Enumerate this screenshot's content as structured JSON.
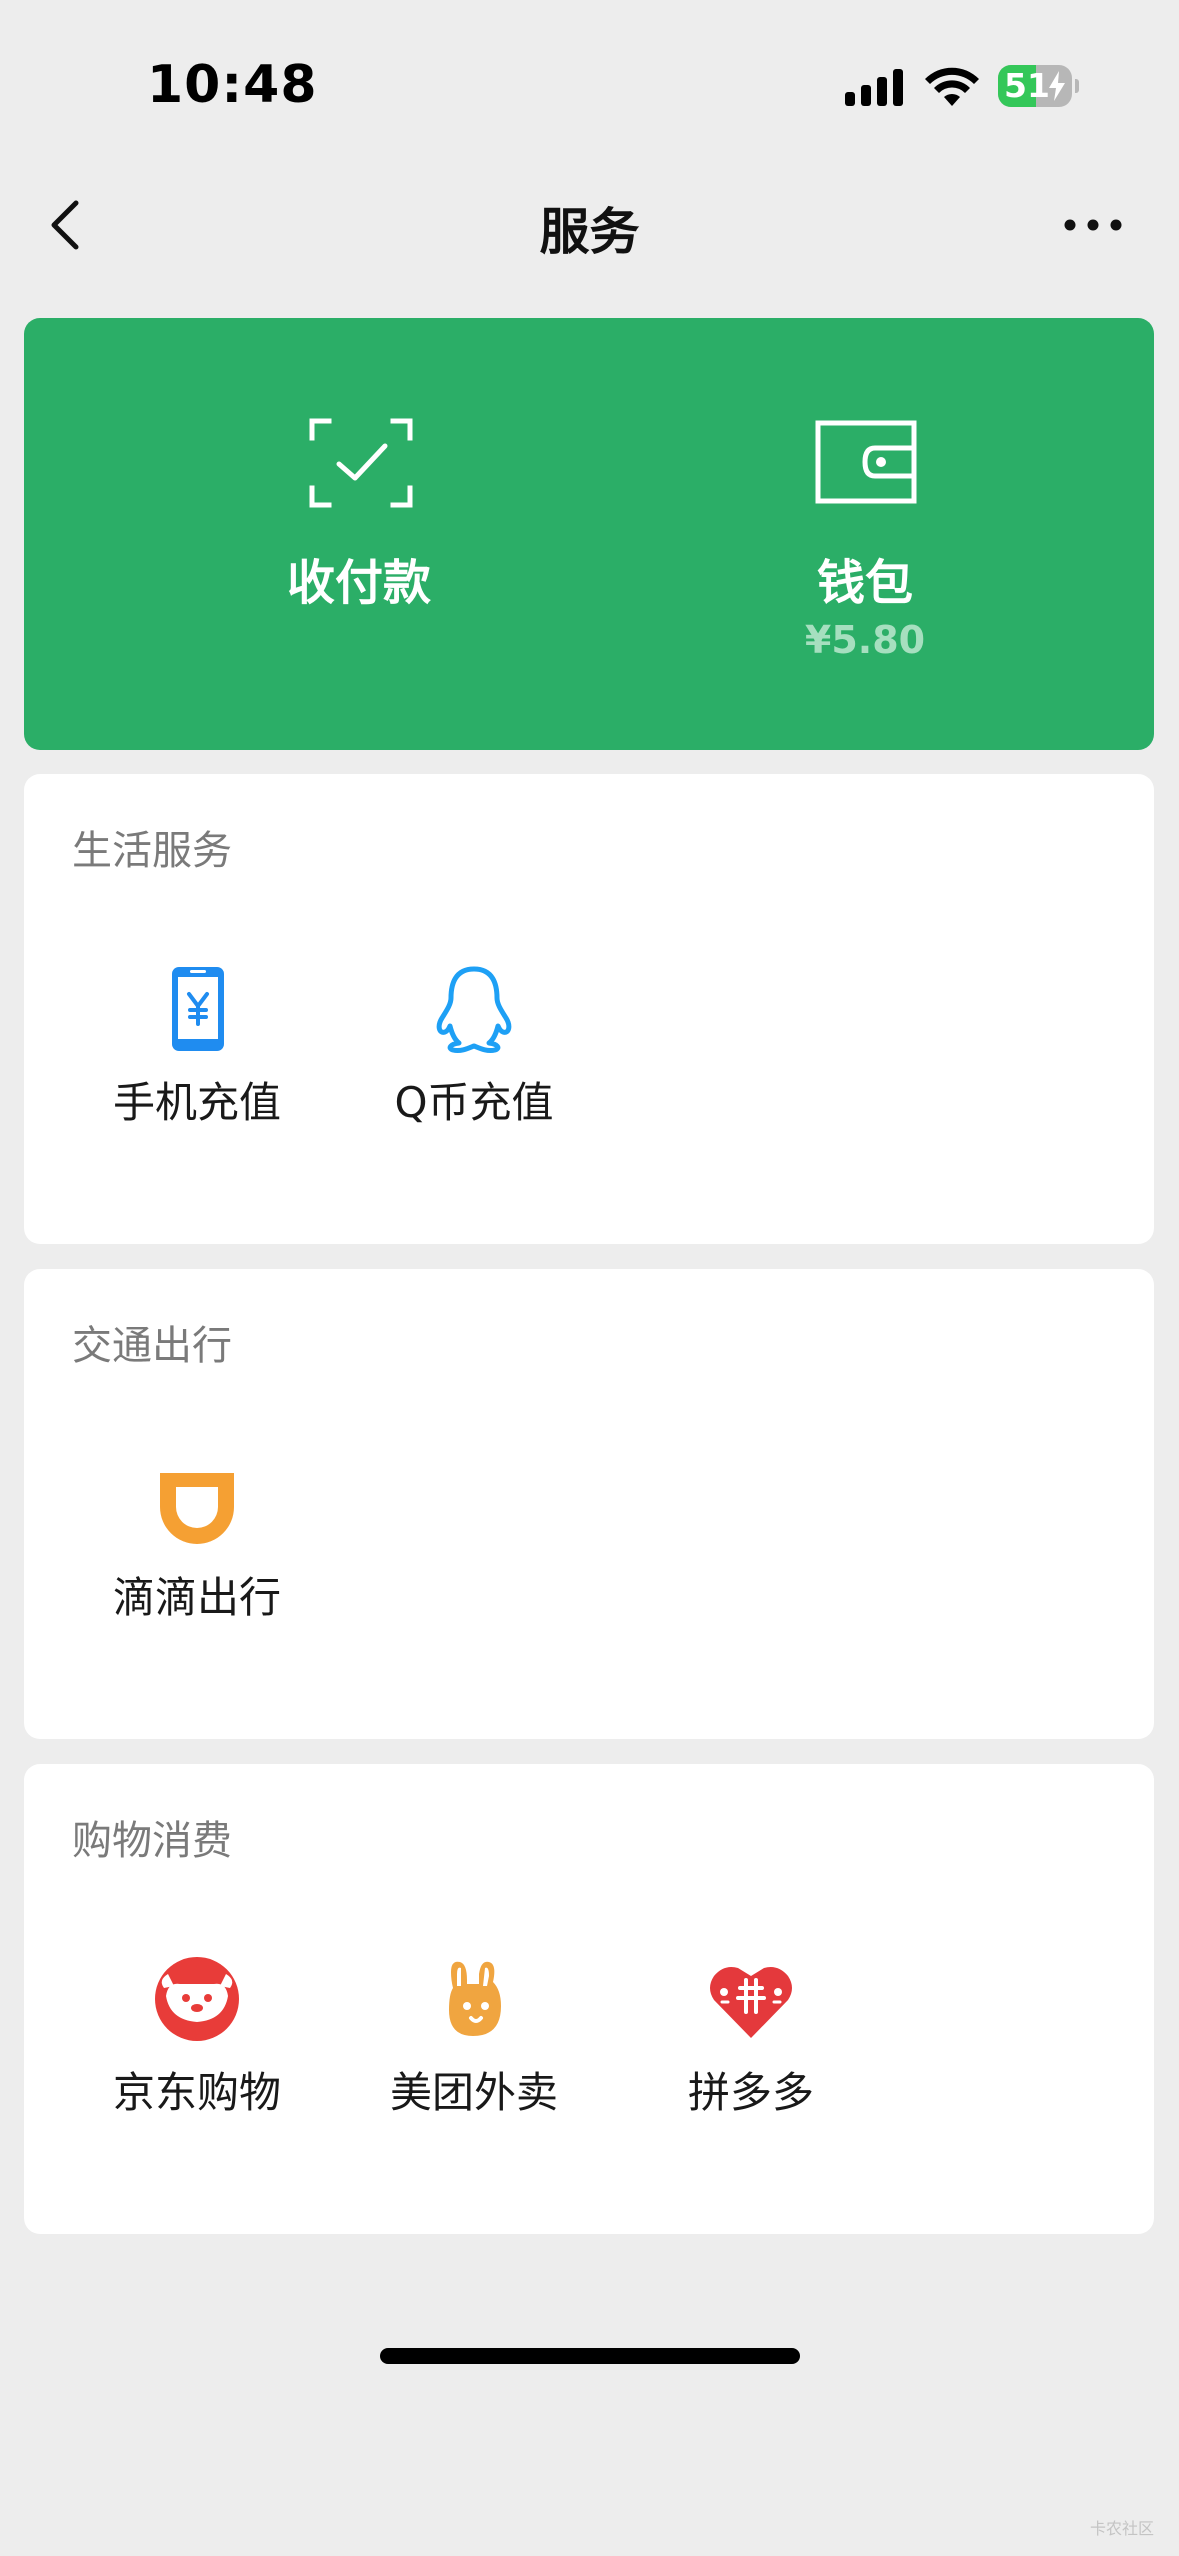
{
  "status_bar": {
    "time": "10:48",
    "battery": "51",
    "battery_percent": 51,
    "icons": [
      "cellular-signal-icon",
      "wifi-icon",
      "battery-charging-icon"
    ]
  },
  "nav": {
    "title": "服务",
    "back_icon": "chevron-left-icon",
    "more_icon": "ellipsis-icon"
  },
  "pay_card": {
    "color": "#2bae67",
    "items": [
      {
        "label": "收付款",
        "icon": "scan-check-icon"
      },
      {
        "label": "钱包",
        "icon": "wallet-icon",
        "sub": "¥5.80"
      }
    ]
  },
  "sections": [
    {
      "title": "生活服务",
      "items": [
        {
          "label": "手机充值",
          "icon": "mobile-topup-icon",
          "color": "#1f8cf0"
        },
        {
          "label": "Q币充值",
          "icon": "qq-penguin-icon",
          "color": "#1ea0f5"
        }
      ]
    },
    {
      "title": "交通出行",
      "items": [
        {
          "label": "滴滴出行",
          "icon": "didi-icon",
          "color": "#f5a033"
        }
      ]
    },
    {
      "title": "购物消费",
      "items": [
        {
          "label": "京东购物",
          "icon": "jd-dog-icon",
          "color": "#e83c39"
        },
        {
          "label": "美团外卖",
          "icon": "meituan-rabbit-icon",
          "color": "#f0a540"
        },
        {
          "label": "拼多多",
          "icon": "pinduoduo-icon",
          "color": "#e4393c"
        }
      ]
    }
  ],
  "watermark": "卡农社区"
}
